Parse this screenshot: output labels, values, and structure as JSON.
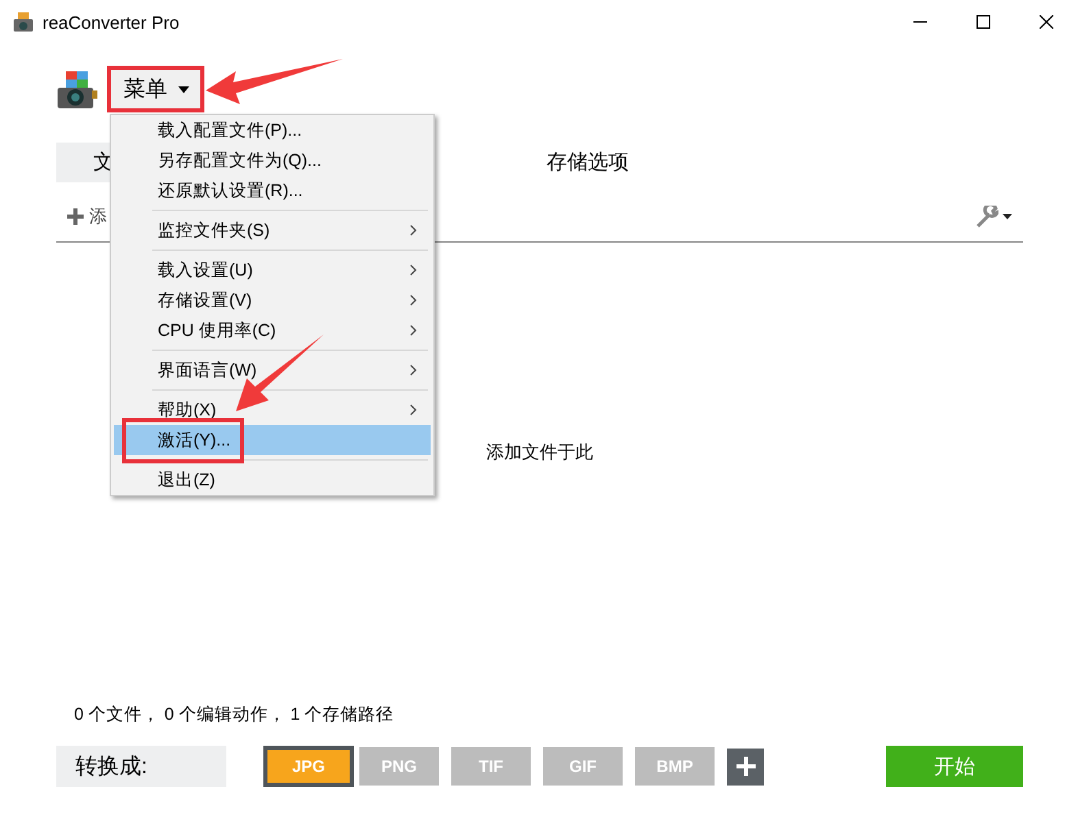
{
  "window": {
    "title": "reaConverter Pro"
  },
  "menu_button": {
    "label": "菜单"
  },
  "tabs": [
    {
      "label": "文",
      "selected": true
    },
    {
      "label": "存储选项",
      "selected": false
    }
  ],
  "toolbar": {
    "add_label": "添"
  },
  "drop_area": {
    "hint": "添加文件于此"
  },
  "status": "0 个文件， 0 个编辑动作， 1 个存储路径",
  "format_bar": {
    "label": "转换成:",
    "formats": [
      {
        "label": "JPG",
        "selected": true
      },
      {
        "label": "PNG",
        "selected": false
      },
      {
        "label": "TIF",
        "selected": false
      },
      {
        "label": "GIF",
        "selected": false
      },
      {
        "label": "BMP",
        "selected": false
      }
    ],
    "start": "开始"
  },
  "menu": {
    "groups": [
      [
        {
          "label": "载入配置文件(P)...",
          "submenu": false,
          "selected": false
        },
        {
          "label": "另存配置文件为(Q)...",
          "submenu": false,
          "selected": false
        },
        {
          "label": "还原默认设置(R)...",
          "submenu": false,
          "selected": false
        }
      ],
      [
        {
          "label": "监控文件夹(S)",
          "submenu": true,
          "selected": false
        }
      ],
      [
        {
          "label": "载入设置(U)",
          "submenu": true,
          "selected": false
        },
        {
          "label": "存储设置(V)",
          "submenu": true,
          "selected": false
        },
        {
          "label": "CPU 使用率(C)",
          "submenu": true,
          "selected": false
        }
      ],
      [
        {
          "label": "界面语言(W)",
          "submenu": true,
          "selected": false
        }
      ],
      [
        {
          "label": "帮助(X)",
          "submenu": true,
          "selected": false
        },
        {
          "label": "激活(Y)...",
          "submenu": false,
          "selected": true
        }
      ],
      [
        {
          "label": "退出(Z)",
          "submenu": false,
          "selected": false
        }
      ]
    ]
  }
}
